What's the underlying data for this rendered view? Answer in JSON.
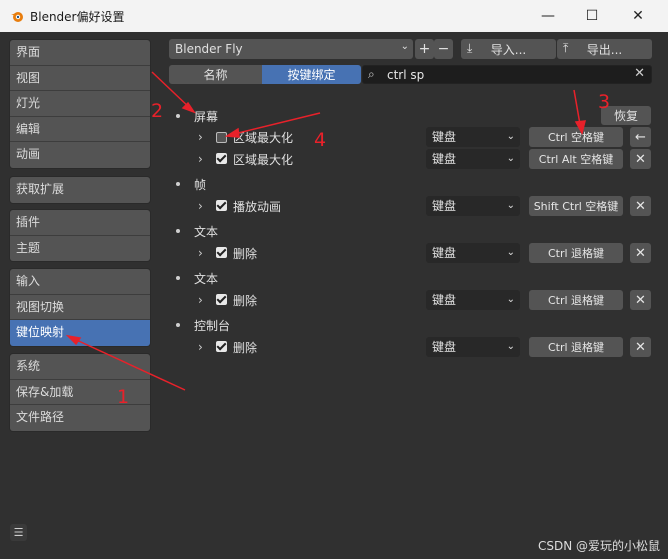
{
  "window": {
    "title": "Blender偏好设置"
  },
  "sidebar": {
    "groups": [
      [
        "界面",
        "视图",
        "灯光",
        "编辑",
        "动画"
      ],
      [
        "获取扩展"
      ],
      [
        "插件",
        "主题"
      ],
      [
        "输入",
        "视图切换",
        "键位映射"
      ],
      [
        "系统",
        "保存&加载",
        "文件路径"
      ]
    ]
  },
  "toolbar": {
    "preset": "Blender Fly",
    "add": "+",
    "remove": "−",
    "import": "导入...",
    "export": "导出..."
  },
  "tabs": {
    "name": "名称",
    "binding": "按键绑定"
  },
  "search": {
    "value": "ctrl sp"
  },
  "restore": "恢复",
  "categories": [
    {
      "name": "屏幕",
      "items": [
        {
          "label": "区域最大化",
          "checked": false,
          "device": "键盘",
          "key": "Ctrl 空格键",
          "action": "←"
        },
        {
          "label": "区域最大化",
          "checked": true,
          "device": "键盘",
          "key": "Ctrl Alt 空格键",
          "action": "✕"
        }
      ]
    },
    {
      "name": "帧",
      "items": [
        {
          "label": "播放动画",
          "checked": true,
          "device": "键盘",
          "key": "Shift Ctrl 空格键",
          "action": "✕"
        }
      ]
    },
    {
      "name": "文本",
      "items": [
        {
          "label": "删除",
          "checked": true,
          "device": "键盘",
          "key": "Ctrl 退格键",
          "action": "✕"
        }
      ]
    },
    {
      "name": "文本",
      "items": [
        {
          "label": "删除",
          "checked": true,
          "device": "键盘",
          "key": "Ctrl 退格键",
          "action": "✕"
        }
      ]
    },
    {
      "name": "控制台",
      "items": [
        {
          "label": "删除",
          "checked": true,
          "device": "键盘",
          "key": "Ctrl 退格键",
          "action": "✕"
        }
      ]
    }
  ],
  "annotations": [
    "1",
    "2",
    "3",
    "4"
  ],
  "watermark": "CSDN @爱玩的小松鼠",
  "colors": {
    "accent": "#4772b3",
    "annotation": "#e8212a"
  }
}
